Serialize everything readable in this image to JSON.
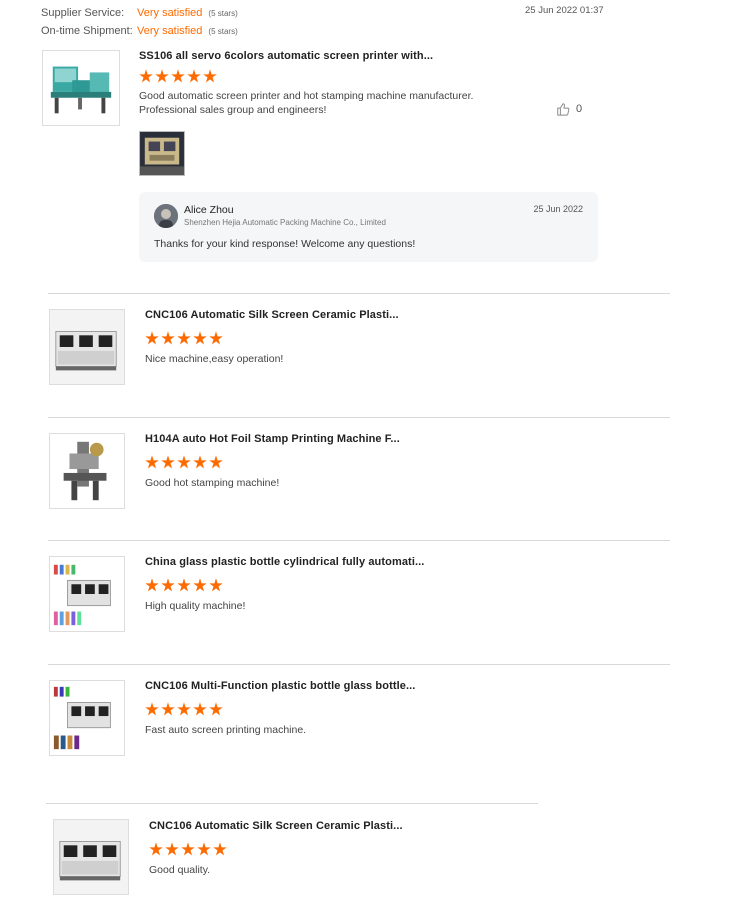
{
  "ratings": {
    "supplier_service": {
      "label": "Supplier Service:",
      "value": "Very satisfied",
      "stars": "(5 stars)"
    },
    "ontime_shipment": {
      "label": "On-time Shipment:",
      "value": "Very satisfied",
      "stars": "(5 stars)"
    },
    "date": "25 Jun 2022 01:37"
  },
  "featured_review": {
    "title": "SS106 all servo 6colors automatic screen printer with...",
    "rating": 5,
    "comment_line1": "Good automatic screen printer and hot stamping machine manufacturer.",
    "comment_line2": "Professional sales group and engineers!",
    "likes": "0",
    "reply": {
      "name": "Alice Zhou",
      "company": "Shenzhen Hejia Automatic Packing Machine Co., Limited",
      "date": "25 Jun 2022",
      "text": "Thanks for your kind response! Welcome any questions!"
    }
  },
  "reviews": [
    {
      "title": "CNC106 Automatic Silk Screen Ceramic Plasti...",
      "rating": 5,
      "comment": "Nice machine,easy operation!"
    },
    {
      "title": "H104A auto Hot Foil Stamp Printing Machine F...",
      "rating": 5,
      "comment": "Good hot stamping machine!"
    },
    {
      "title": "China glass plastic bottle cylindrical fully automati...",
      "rating": 5,
      "comment": "High quality machine!"
    },
    {
      "title": "CNC106 Multi-Function plastic bottle glass bottle...",
      "rating": 5,
      "comment": "Fast auto screen printing machine."
    },
    {
      "title": "CNC106 Automatic Silk Screen Ceramic Plasti...",
      "rating": 5,
      "comment": "Good quality."
    }
  ],
  "colors": {
    "accent": "#ff6a00",
    "divider": "#d8d8d8",
    "reply_bg": "#f5f6f8"
  },
  "icons": {
    "like": "thumbs-up-icon",
    "star": "star-icon"
  }
}
